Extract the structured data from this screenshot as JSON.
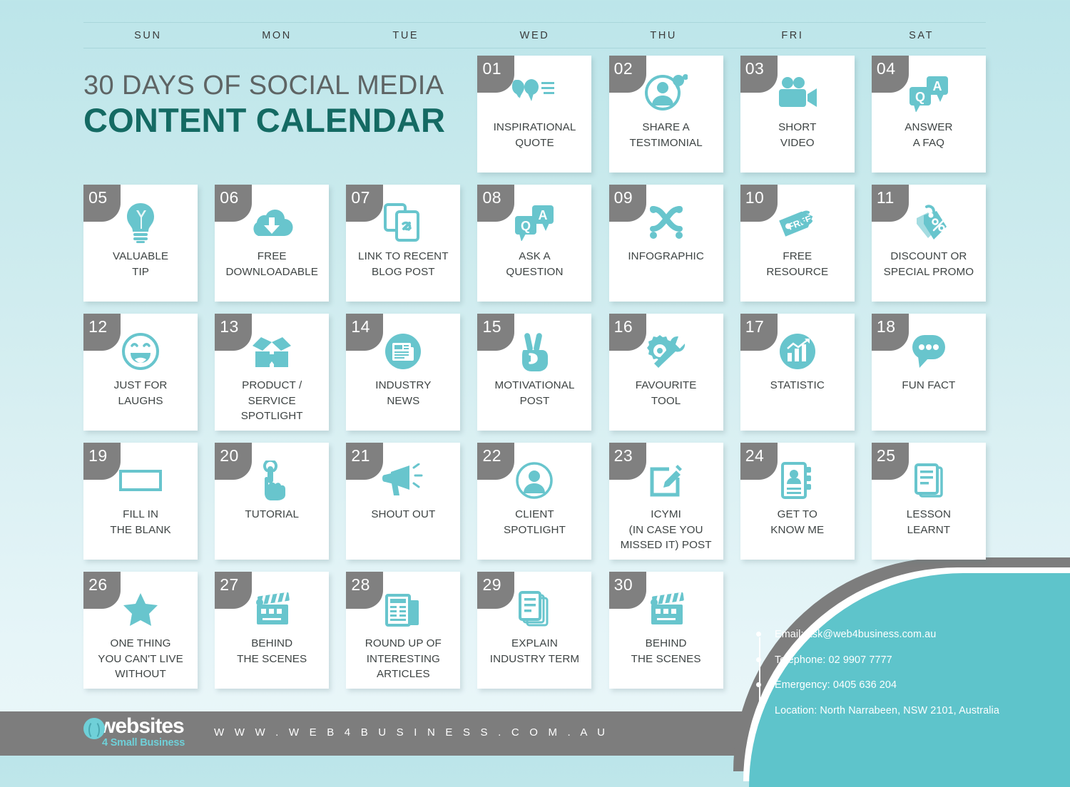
{
  "title": {
    "line1": "30 DAYS OF SOCIAL MEDIA",
    "line2": "CONTENT CALENDAR"
  },
  "weekdays": [
    "SUN",
    "MON",
    "TUE",
    "WED",
    "THU",
    "FRI",
    "SAT"
  ],
  "colors": {
    "accent_teal": "#5ec4cb",
    "icon_teal": "#68c5cd",
    "badge_gray": "#808080",
    "title_dark": "#146a63",
    "title_gray": "#5e6464",
    "bg_top": "#bce5ea",
    "bg_bottom": "#eaf6f9",
    "footer_gray": "#7d7d7d"
  },
  "days": [
    {
      "num": "01",
      "label": "INSPIRATIONAL\nQUOTE",
      "icon": "quote-bubbles-icon"
    },
    {
      "num": "02",
      "label": "SHARE A\nTESTIMONIAL",
      "icon": "person-testimonial-icon"
    },
    {
      "num": "03",
      "label": "SHORT\nVIDEO",
      "icon": "video-camera-icon"
    },
    {
      "num": "04",
      "label": "ANSWER\nA FAQ",
      "icon": "qa-bubbles-icon"
    },
    {
      "num": "05",
      "label": "VALUABLE\nTIP",
      "icon": "lightbulb-icon"
    },
    {
      "num": "06",
      "label": "FREE\nDOWNLOADABLE",
      "icon": "cloud-download-icon"
    },
    {
      "num": "07",
      "label": "LINK TO RECENT\nBLOG POST",
      "icon": "document-link-icon"
    },
    {
      "num": "08",
      "label": "ASK A\nQUESTION",
      "icon": "qa-bubbles-icon"
    },
    {
      "num": "09",
      "label": "INFOGRAPHIC",
      "icon": "infographic-knot-icon"
    },
    {
      "num": "10",
      "label": "FREE\nRESOURCE",
      "icon": "free-tag-icon"
    },
    {
      "num": "11",
      "label": "DISCOUNT OR\nSPECIAL PROMO",
      "icon": "percent-tags-icon"
    },
    {
      "num": "12",
      "label": "JUST FOR\nLAUGHS",
      "icon": "smiley-face-icon"
    },
    {
      "num": "13",
      "label": "PRODUCT /\nSERVICE\nSPOTLIGHT",
      "icon": "open-box-icon"
    },
    {
      "num": "14",
      "label": "INDUSTRY\nNEWS",
      "icon": "news-circle-icon"
    },
    {
      "num": "15",
      "label": "MOTIVATIONAL\nPOST",
      "icon": "peace-hand-icon"
    },
    {
      "num": "16",
      "label": "FAVOURITE\nTOOL",
      "icon": "gear-wrench-icon"
    },
    {
      "num": "17",
      "label": "STATISTIC",
      "icon": "chart-circle-icon"
    },
    {
      "num": "18",
      "label": "FUN FACT",
      "icon": "chat-dots-icon"
    },
    {
      "num": "19",
      "label": "FILL IN\nTHE BLANK",
      "icon": "blank-rectangle-icon"
    },
    {
      "num": "20",
      "label": "TUTORIAL",
      "icon": "tap-hand-icon"
    },
    {
      "num": "21",
      "label": "SHOUT OUT",
      "icon": "megaphone-icon"
    },
    {
      "num": "22",
      "label": "CLIENT\nSPOTLIGHT",
      "icon": "user-circle-icon"
    },
    {
      "num": "23",
      "label": "ICYMI\n(IN CASE YOU\nMISSED IT) POST",
      "icon": "edit-pencil-icon"
    },
    {
      "num": "24",
      "label": "GET TO\nKNOW ME",
      "icon": "profile-card-icon"
    },
    {
      "num": "25",
      "label": "LESSON\nLEARNT",
      "icon": "document-stack-icon"
    },
    {
      "num": "26",
      "label": "ONE THING\nYOU CAN'T LIVE\nWITHOUT",
      "icon": "star-icon"
    },
    {
      "num": "27",
      "label": "BEHIND\nTHE SCENES",
      "icon": "clapperboard-icon"
    },
    {
      "num": "28",
      "label": "ROUND UP OF\nINTERESTING\nARTICLES",
      "icon": "newspaper-icon"
    },
    {
      "num": "29",
      "label": "EXPLAIN\nINDUSTRY TERM",
      "icon": "document-lines-icon"
    },
    {
      "num": "30",
      "label": "BEHIND\nTHE SCENES",
      "icon": "clapperboard-icon"
    }
  ],
  "contact": {
    "email": "Email: ask@web4business.com.au",
    "telephone": "Telephone: 02 9907 7777",
    "emergency": "Emergency: 0405 636 204",
    "location": "Location:  North Narrabeen, NSW 2101, Australia"
  },
  "footer": {
    "logo_main": "websites",
    "logo_sub": "4 Small Business",
    "url": "W W W . W E B 4 B U S I N E S S . C O M . A U"
  }
}
